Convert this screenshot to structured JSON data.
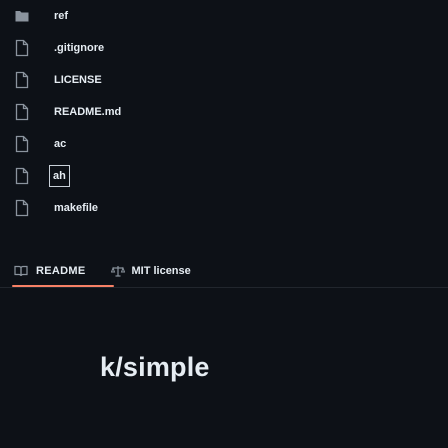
{
  "files": [
    {
      "name": "ref",
      "type": "folder",
      "icon": "folder-icon"
    },
    {
      "name": ".gitignore",
      "type": "file",
      "icon": "file-icon"
    },
    {
      "name": "LICENSE",
      "type": "file",
      "icon": "file-icon"
    },
    {
      "name": "README.md",
      "type": "file",
      "icon": "file-icon"
    },
    {
      "name": "ac",
      "type": "file",
      "icon": "file-icon"
    },
    {
      "name": "ah",
      "type": "file",
      "icon": "file-icon",
      "selected": true
    },
    {
      "name": "makefile",
      "type": "file",
      "icon": "file-icon"
    }
  ],
  "readme": {
    "tab_label": "README",
    "tab_icon": "book-icon",
    "license_label": "MIT license",
    "license_icon": "scale-icon",
    "accent_color": "#f78166"
  },
  "project": {
    "title": "k/simple"
  }
}
